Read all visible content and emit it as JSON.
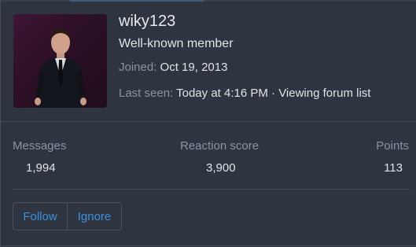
{
  "profile": {
    "username": "wiky123",
    "title": "Well-known member",
    "joined_label": "Joined:",
    "joined_value": "Oct 19, 2013",
    "last_seen_label": "Last seen:",
    "last_seen_value": "Today at 4:16 PM · Viewing forum list"
  },
  "stats": [
    {
      "label": "Messages",
      "value": "1,994"
    },
    {
      "label": "Reaction score",
      "value": "3,900"
    },
    {
      "label": "Points",
      "value": "113"
    }
  ],
  "actions": {
    "follow_label": "Follow",
    "ignore_label": "Ignore"
  },
  "colors": {
    "link": "#3b8fd9",
    "panel": "#2f3540"
  }
}
